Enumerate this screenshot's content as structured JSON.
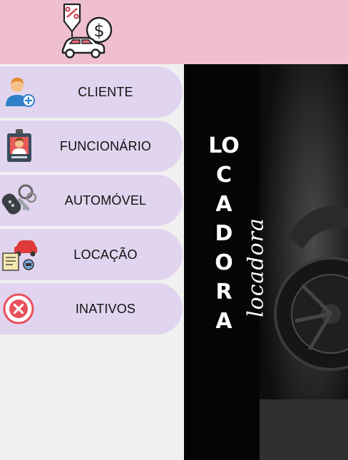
{
  "app": {
    "logo_icon": "car-discount-price-icon",
    "colors": {
      "header_bg": "#efbfd1",
      "menu_item_bg": "#e1d4ee",
      "content_bg": "#f0f0f0",
      "banner_bg": "#050505"
    }
  },
  "menu": {
    "items": [
      {
        "label": "CLIENTE",
        "icon": "client-user-add-icon"
      },
      {
        "label": "FUNCIONÁRIO",
        "icon": "employee-badge-icon"
      },
      {
        "label": "AUTOMÓVEL",
        "icon": "car-keys-icon"
      },
      {
        "label": "LOCAÇÃO",
        "icon": "rental-contract-car-icon"
      },
      {
        "label": "INATIVOS",
        "icon": "inactive-x-icon"
      }
    ]
  },
  "banner": {
    "title": "LOCADORA",
    "subtitle": "locadora"
  }
}
